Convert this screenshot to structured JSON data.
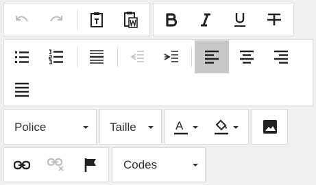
{
  "toolbar": {
    "undo": {
      "icon": "undo-icon",
      "enabled": false
    },
    "redo": {
      "icon": "redo-icon",
      "enabled": false
    },
    "paste_text": {
      "icon": "clipboard-text-icon"
    },
    "paste_word": {
      "icon": "clipboard-word-icon"
    },
    "bold": {
      "icon": "bold-icon"
    },
    "italic": {
      "icon": "italic-icon"
    },
    "underline": {
      "icon": "underline-icon"
    },
    "strikethrough": {
      "icon": "strikethrough-icon"
    },
    "bullet_list": {
      "icon": "bullet-list-icon"
    },
    "numbered_list": {
      "icon": "numbered-list-icon"
    },
    "horizontal_rule": {
      "icon": "horizontal-rule-icon"
    },
    "outdent": {
      "icon": "outdent-icon",
      "enabled": false
    },
    "indent": {
      "icon": "indent-icon"
    },
    "align_left": {
      "icon": "align-left-icon",
      "active": true
    },
    "align_center": {
      "icon": "align-center-icon"
    },
    "align_right": {
      "icon": "align-right-icon"
    },
    "justify": {
      "icon": "justify-icon"
    },
    "font_select": {
      "label": "Police"
    },
    "size_select": {
      "label": "Taille"
    },
    "text_color": {
      "icon": "text-color-icon",
      "letter": "A"
    },
    "background_color": {
      "icon": "fill-color-icon"
    },
    "image": {
      "icon": "image-icon"
    },
    "link": {
      "icon": "link-icon"
    },
    "unlink": {
      "icon": "unlink-icon",
      "enabled": false
    },
    "anchor": {
      "icon": "flag-icon"
    },
    "codes_select": {
      "label": "Codes"
    }
  },
  "colors": {
    "icon": "#222222",
    "icon_disabled": "#b8b8b8",
    "active_bg": "#c8c8c8",
    "toolbar_bg": "#f0f0f0"
  }
}
